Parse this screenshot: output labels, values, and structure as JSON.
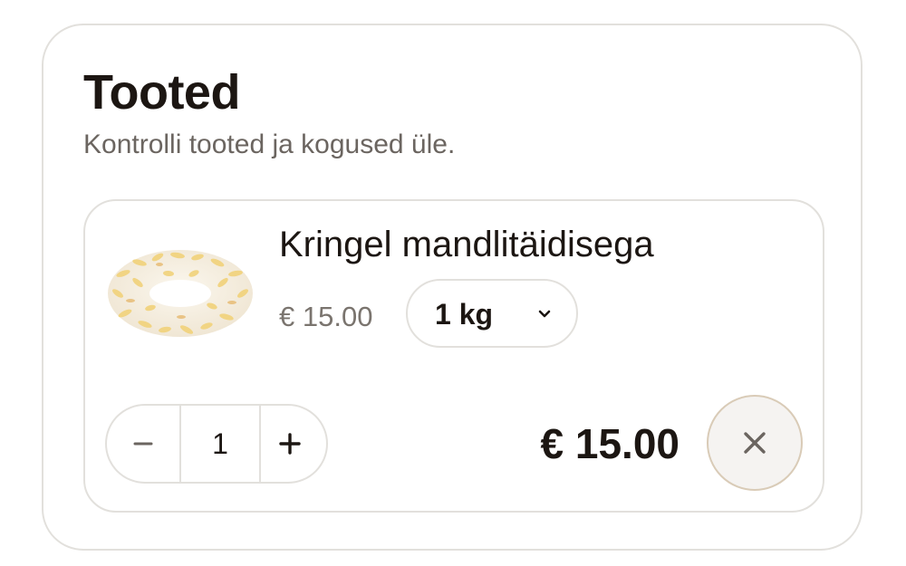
{
  "section": {
    "title": "Tooted",
    "subtitle": "Kontrolli tooted ja kogused üle."
  },
  "product": {
    "image_alt": "Kringel mandlitäidisega",
    "name": "Kringel mandlitäidisega",
    "unit_price": "€ 15.00",
    "size": "1 kg",
    "quantity": "1",
    "total": "€ 15.00"
  },
  "icons": {
    "size_dropdown": "chevron-down-icon",
    "decrease": "minus-icon",
    "increase": "plus-icon",
    "remove": "close-icon"
  },
  "colors": {
    "text": "#1c1612",
    "muted": "#6b6560",
    "border": "#e2e0dc",
    "remove_border": "#d9cbb7",
    "remove_bg": "#f5f3f1"
  }
}
